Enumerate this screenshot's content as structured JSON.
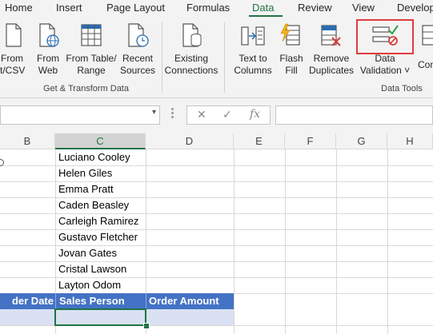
{
  "ribbon_tabs": [
    "Home",
    "Insert",
    "Page Layout",
    "Formulas",
    "Data",
    "Review",
    "View",
    "Develop"
  ],
  "active_tab": "Data",
  "ribbon": {
    "from_text": [
      "From",
      "xt/CSV"
    ],
    "from_web": [
      "From",
      "Web"
    ],
    "from_table": [
      "From Table/",
      "Range"
    ],
    "recent_sources": [
      "Recent",
      "Sources"
    ],
    "existing_connections": [
      "Existing",
      "Connections"
    ],
    "text_to_columns": [
      "Text to",
      "Columns"
    ],
    "flash_fill": [
      "Flash",
      "Fill"
    ],
    "remove_duplicates": [
      "Remove",
      "Duplicates"
    ],
    "data_validation": [
      "Data",
      "Validation ˅"
    ],
    "consolidate": "Cons",
    "group_get_transform": "Get & Transform Data",
    "group_data_tools": "Data Tools"
  },
  "formula_bar": {
    "namebox_arrow": "▾",
    "cancel": "✕",
    "enter": "✓",
    "fx": "fx"
  },
  "columns": [
    "B",
    "C",
    "D",
    "E",
    "F",
    "G",
    "H"
  ],
  "selected_column": "C",
  "names": [
    "Luciano Cooley",
    "Helen Giles",
    "Emma Pratt",
    "Caden Beasley",
    "Carleigh Ramirez",
    "Gustavo Fletcher",
    "Jovan Gates",
    "Cristal Lawson",
    "Layton Odom"
  ],
  "table_headers": [
    "der Date",
    "Sales Person",
    "Order Amount"
  ],
  "colors": {
    "accent": "#217346",
    "table_header": "#4472c4",
    "table_band": "#d9e1f2",
    "highlight": "#e03c3c"
  }
}
